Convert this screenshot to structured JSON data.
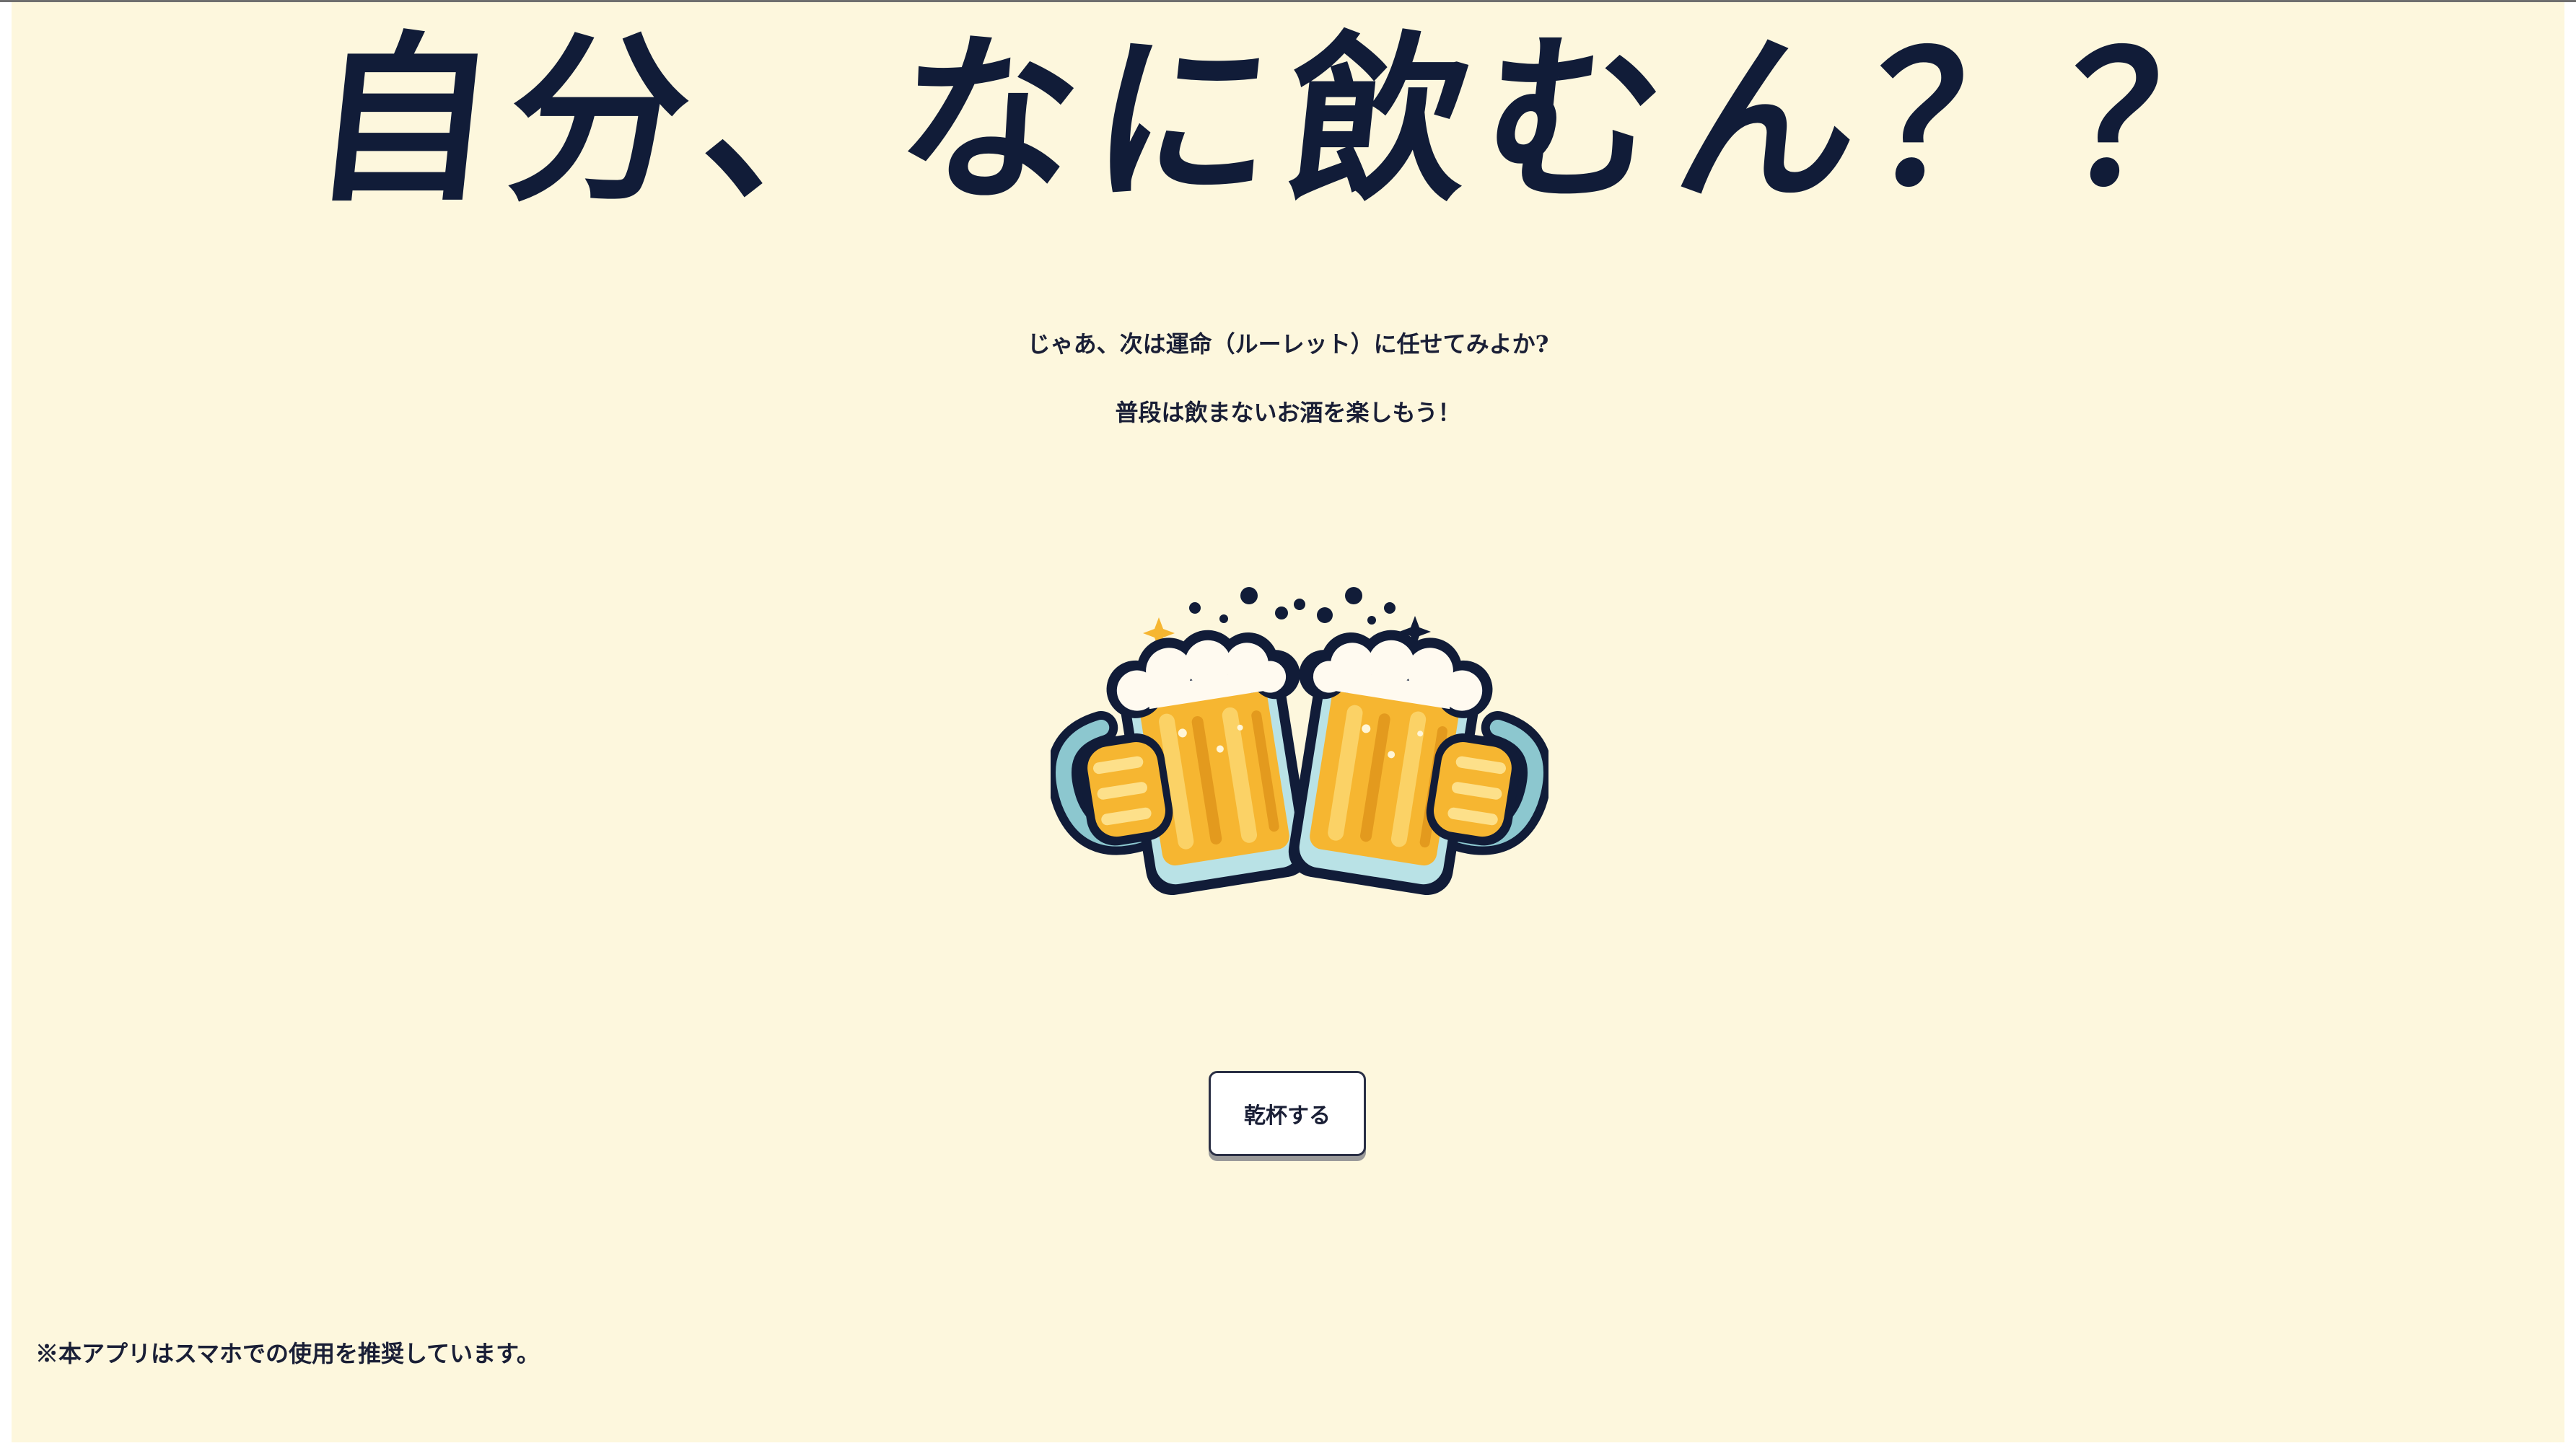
{
  "header": {
    "title": "自分、なに飲むん？？"
  },
  "intro": {
    "line1": "じゃあ、次は運命（ルーレット）に任せてみよか?",
    "line2": "普段は飲まないお酒を楽しもう！"
  },
  "illustration": {
    "icon": "cheers-beer-mugs-icon"
  },
  "actions": {
    "toast_label": "乾杯する"
  },
  "footer": {
    "note": "※本アプリはスマホでの使用を推奨しています。"
  },
  "colors": {
    "page_background": "#fdf7dd",
    "ink": "#111c38",
    "beer": "#f6b631",
    "foam": "#fffaf0"
  }
}
